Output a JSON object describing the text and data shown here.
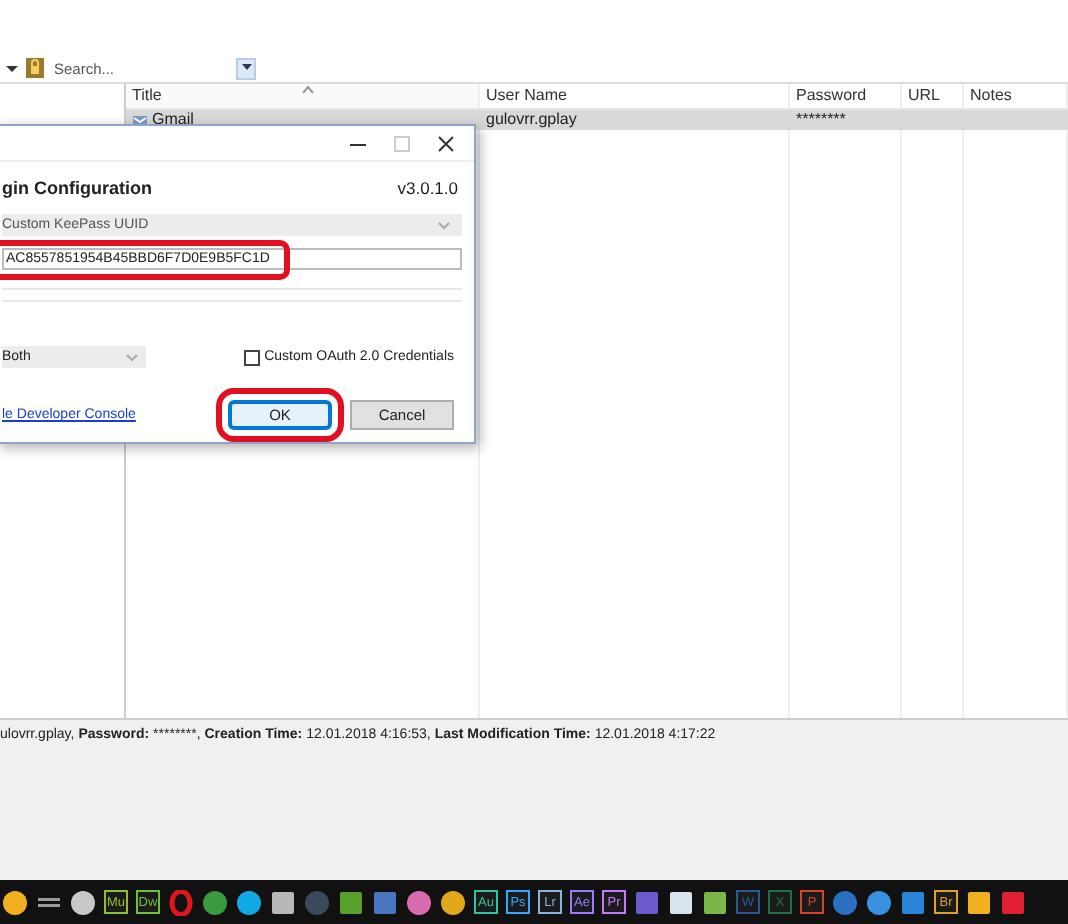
{
  "toolbar": {
    "search": {
      "placeholder": "Search..."
    }
  },
  "table": {
    "columns": [
      {
        "label": "Title",
        "sorted": true
      },
      {
        "label": "User Name",
        "sorted": false
      },
      {
        "label": "Password",
        "sorted": false
      },
      {
        "label": "URL",
        "sorted": false
      },
      {
        "label": "Notes",
        "sorted": false
      }
    ],
    "rows": [
      {
        "selected": true,
        "cells": [
          "Gmail",
          "gulovrr.gplay",
          "********",
          "",
          ""
        ]
      }
    ]
  },
  "dialog": {
    "title": "gin Configuration",
    "version": "v3.0.1.0",
    "source": {
      "value": "Custom KeePass UUID",
      "disabled": true
    },
    "uuid": {
      "value": "AC8557851954B45BBD6F7D0E9B5FC1D",
      "highlighted": true
    },
    "mode": {
      "value": "Both"
    },
    "custom_oauth": {
      "label": "Custom OAuth 2.0 Credentials",
      "checked": false
    },
    "link": "le Developer Console",
    "buttons": [
      {
        "label": "OK",
        "highlighted": true
      },
      {
        "label": "Cancel",
        "highlighted": false
      }
    ]
  },
  "details": [
    {
      "value": "ulovrr.gplay,"
    },
    {
      "label": "Password:",
      "value": "********,"
    },
    {
      "label": "Creation Time:",
      "value": "12.01.2018 4:16:53,"
    },
    {
      "label": "Last Modification Time:",
      "value": "12.01.2018 4:17:22"
    }
  ],
  "taskbar": [
    {
      "kind": "round",
      "color": "#f2b01e"
    },
    {
      "kind": "lines",
      "color": "#9a9a9a"
    },
    {
      "kind": "round",
      "color": "#c8c8c8"
    },
    {
      "kind": "tile",
      "label": "Mu",
      "color": "#8fbf2a"
    },
    {
      "kind": "tile",
      "label": "Dw",
      "color": "#6fbf3a"
    },
    {
      "kind": "ring",
      "color": "#e0161e"
    },
    {
      "kind": "round",
      "color": "#3b9a3e"
    },
    {
      "kind": "round",
      "color": "#12a9e6"
    },
    {
      "kind": "square",
      "color": "#b8b8b8"
    },
    {
      "kind": "round",
      "color": "#3a4a5a"
    },
    {
      "kind": "square",
      "color": "#5aa02c"
    },
    {
      "kind": "square",
      "color": "#4a78c0"
    },
    {
      "kind": "round",
      "color": "#d86ab0"
    },
    {
      "kind": "round",
      "color": "#e0a81a"
    },
    {
      "kind": "tile",
      "label": "Au",
      "color": "#2ec4a0"
    },
    {
      "kind": "tile",
      "label": "Ps",
      "color": "#31a8ff"
    },
    {
      "kind": "tile",
      "label": "Lr",
      "color": "#8ab4d8"
    },
    {
      "kind": "tile",
      "label": "Ae",
      "color": "#9a7aff"
    },
    {
      "kind": "tile",
      "label": "Pr",
      "color": "#c37aff"
    },
    {
      "kind": "square",
      "color": "#6a5acd"
    },
    {
      "kind": "square",
      "color": "#d8e4ec"
    },
    {
      "kind": "square",
      "color": "#7ab648"
    },
    {
      "kind": "tile",
      "label": "W",
      "color": "#2b5797"
    },
    {
      "kind": "tile",
      "label": "X",
      "color": "#1e7145"
    },
    {
      "kind": "tile",
      "label": "P",
      "color": "#d24726"
    },
    {
      "kind": "round",
      "color": "#2a6fc0"
    },
    {
      "kind": "round",
      "color": "#3a8fe0"
    },
    {
      "kind": "square",
      "color": "#2a84d8"
    },
    {
      "kind": "tile",
      "label": "Br",
      "color": "#e0a020"
    },
    {
      "kind": "square",
      "color": "#f0b020"
    },
    {
      "kind": "square",
      "color": "#e02030"
    }
  ]
}
